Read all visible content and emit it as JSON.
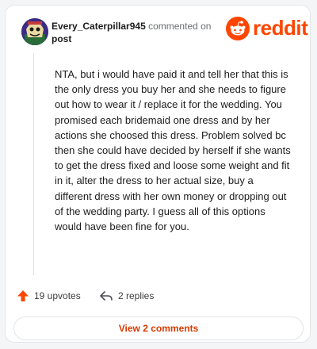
{
  "comment": {
    "username": "Every_Caterpillar945",
    "commented_text": "commented on",
    "post_link": "post",
    "body": "NTA, but i would have paid it and tell her that this is the only dress you buy her and she needs to figure out how to wear it / replace it for the wedding. You promised each bridemaid one dress and by her actions she choosed this dress. Problem solved bc then she could have decided by herself if she wants to get the dress fixed and loose some weight and fit in it, alter the dress to her actual size, buy a different dress with her own money or dropping out of the wedding party. I guess all of this options would have been fine for you."
  },
  "brand": {
    "logo_text": "reddit",
    "color": "#ff4500"
  },
  "actions": {
    "upvotes": "19 upvotes",
    "replies": "2 replies"
  },
  "footer": {
    "view_comments": "View 2 comments"
  },
  "icons": {
    "upvote": "upvote-arrow-icon",
    "reply": "reply-arrow-icon",
    "logo": "reddit-snoo-icon",
    "avatar": "user-avatar"
  }
}
